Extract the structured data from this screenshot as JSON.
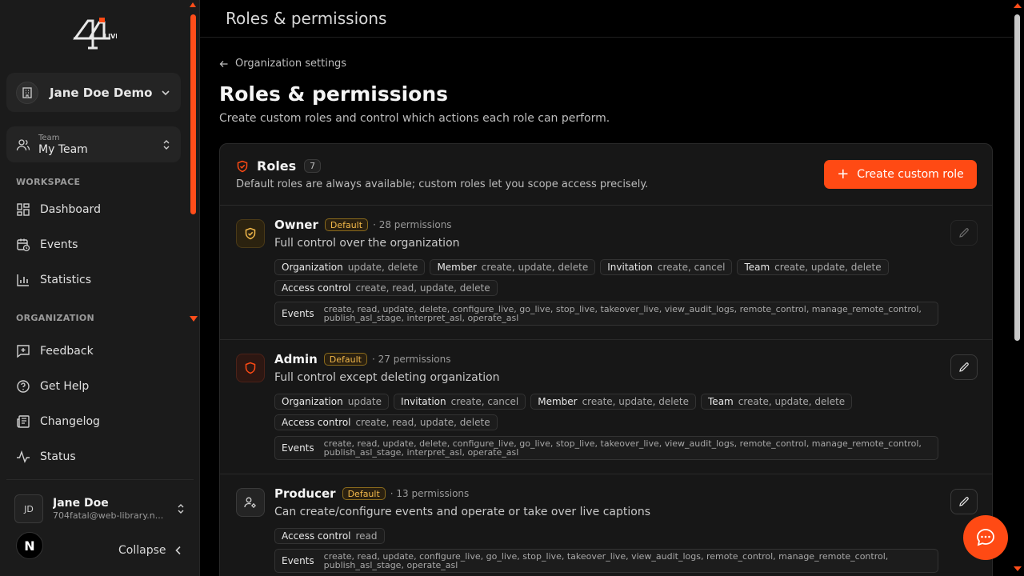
{
  "sidebar": {
    "org_name": "Jane Doe Demo",
    "team_label": "Team",
    "team_name": "My Team",
    "workspace_label": "WORKSPACE",
    "workspace_items": [
      {
        "label": "Dashboard",
        "icon": "dashboard-icon"
      },
      {
        "label": "Events",
        "icon": "calendar-clock-icon"
      },
      {
        "label": "Statistics",
        "icon": "bar-chart-icon"
      }
    ],
    "organization_label": "ORGANIZATION",
    "organization_items": [
      {
        "label": "Feedback",
        "icon": "message-plus-icon"
      },
      {
        "label": "Get Help",
        "icon": "help-circle-icon"
      },
      {
        "label": "Changelog",
        "icon": "newspaper-icon"
      },
      {
        "label": "Status",
        "icon": "activity-icon"
      }
    ],
    "user": {
      "initials": "JD",
      "name": "Jane Doe",
      "email": "704fatal@web-library.n..."
    },
    "n_badge": "N",
    "collapse_label": "Collapse"
  },
  "topbar": {
    "title": "Roles & permissions"
  },
  "page": {
    "back_label": "Organization settings",
    "title": "Roles & permissions",
    "description": "Create custom roles and control which actions each role can perform."
  },
  "roles_card": {
    "title": "Roles",
    "count": "7",
    "subtitle": "Default roles are always available; custom roles let you scope access precisely.",
    "create_label": "Create custom role"
  },
  "roles": [
    {
      "name": "Owner",
      "badge": "Default",
      "perm_count": "· 28 permissions",
      "description": "Full control over the organization",
      "chips": [
        {
          "resource": "Organization",
          "actions": "update, delete"
        },
        {
          "resource": "Member",
          "actions": "create, update, delete"
        },
        {
          "resource": "Invitation",
          "actions": "create, cancel"
        },
        {
          "resource": "Team",
          "actions": "create, update, delete"
        },
        {
          "resource": "Access control",
          "actions": "create, read, update, delete"
        }
      ],
      "events": {
        "resource": "Events",
        "actions": "create, read, update, delete, configure_live, go_live, stop_live, takeover_live, view_audit_logs, remote_control, manage_remote_control, publish_asl_stage, interpret_asl, operate_asl"
      }
    },
    {
      "name": "Admin",
      "badge": "Default",
      "perm_count": "· 27 permissions",
      "description": "Full control except deleting organization",
      "chips": [
        {
          "resource": "Organization",
          "actions": "update"
        },
        {
          "resource": "Invitation",
          "actions": "create, cancel"
        },
        {
          "resource": "Member",
          "actions": "create, update, delete"
        },
        {
          "resource": "Team",
          "actions": "create, update, delete"
        },
        {
          "resource": "Access control",
          "actions": "create, read, update, delete"
        }
      ],
      "events": {
        "resource": "Events",
        "actions": "create, read, update, delete, configure_live, go_live, stop_live, takeover_live, view_audit_logs, remote_control, manage_remote_control, publish_asl_stage, interpret_asl, operate_asl"
      }
    },
    {
      "name": "Producer",
      "badge": "Default",
      "perm_count": "· 13 permissions",
      "description": "Can create/configure events and operate or take over live captions",
      "chips": [
        {
          "resource": "Access control",
          "actions": "read"
        }
      ],
      "events": {
        "resource": "Events",
        "actions": "create, read, update, configure_live, go_live, stop_live, takeover_live, view_audit_logs, remote_control, manage_remote_control, publish_asl_stage, operate_asl"
      }
    }
  ],
  "colors": {
    "accent": "#ff4a14",
    "badge_gold": "#f2b84a",
    "background": "#000000",
    "sidebar": "#1b1b1b"
  }
}
